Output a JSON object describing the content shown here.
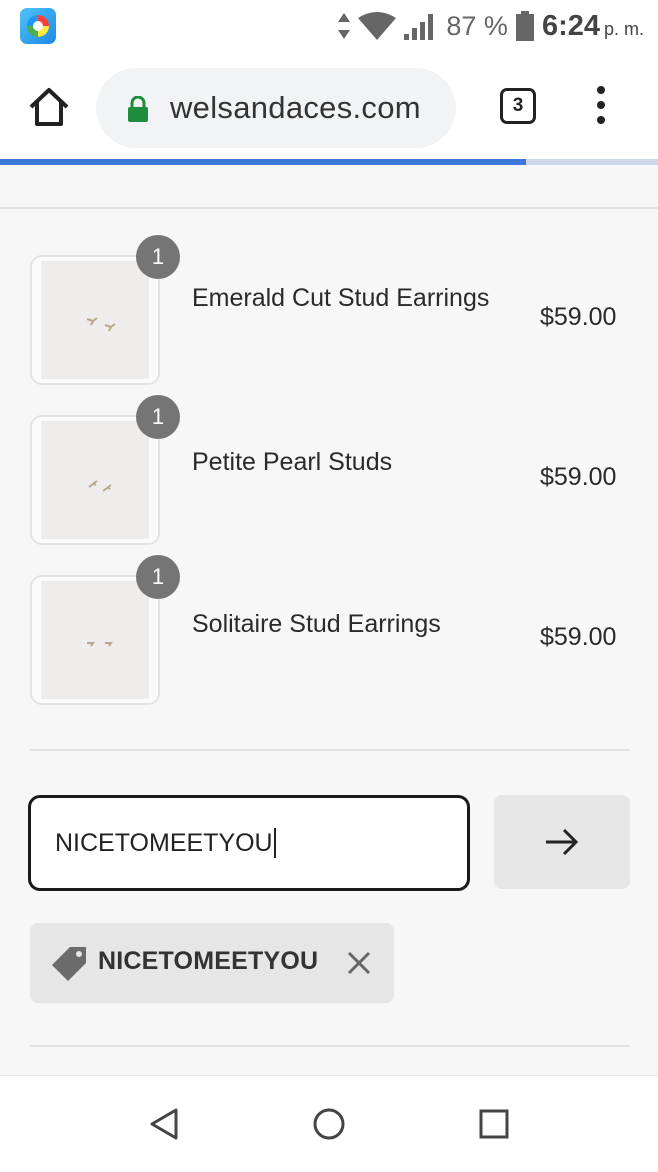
{
  "status_bar": {
    "battery_percent": "87 %",
    "time": "6:24",
    "time_suffix": "p. m."
  },
  "browser": {
    "url": "welsandaces.com",
    "tab_count": "3",
    "load_progress": 0.8
  },
  "cart": {
    "items": [
      {
        "quantity": "1",
        "title": "Emerald Cut Stud Earrings",
        "price": "$59.00"
      },
      {
        "quantity": "1",
        "title": "Petite Pearl Studs",
        "price": "$59.00"
      },
      {
        "quantity": "1",
        "title": "Solitaire Stud Earrings",
        "price": "$59.00"
      }
    ]
  },
  "discount": {
    "input_value": "NICETOMEETYOU",
    "applied_code": "NICETOMEETYOU"
  },
  "icons": {
    "home": "home-icon",
    "lock": "lock-icon",
    "menu": "more-vert-icon",
    "apply": "arrow-right-icon",
    "tag": "tag-icon",
    "remove": "close-icon",
    "back": "back-triangle-icon",
    "home_nav": "home-circle-icon",
    "recents": "recents-square-icon"
  },
  "colors": {
    "lock_green": "#1e8e3e",
    "progress_blue": "#3b78d8",
    "badge_grey": "#757575"
  }
}
